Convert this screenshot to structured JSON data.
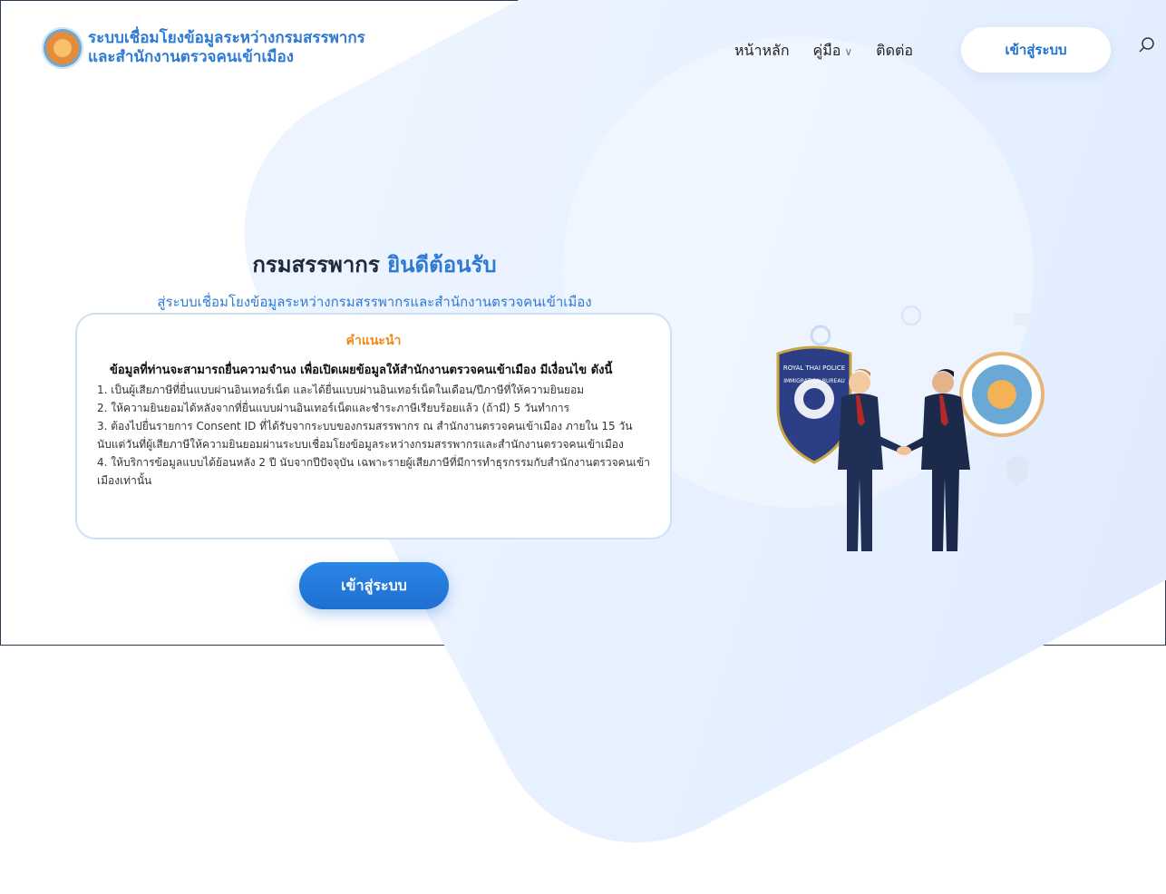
{
  "header": {
    "logo_title_line1": "ระบบเชื่อมโยงข้อมูลระหว่างกรมสรรพากร",
    "logo_title_line2": "และสำนักงานตรวจคนเข้าเมือง",
    "nav": [
      {
        "label": "หน้าหลัก"
      },
      {
        "label": "คู่มือ"
      },
      {
        "label": "ติดต่อ"
      }
    ],
    "login_button": "เข้าสู่ระบบ"
  },
  "welcome": {
    "title_part1": "กรมสรรพากร",
    "title_part2": "ยินดีต้อนรับ",
    "subtitle": "สู่ระบบเชื่อมโยงข้อมูลระหว่างกรมสรรพากรและสำนักงานตรวจคนเข้าเมือง"
  },
  "instructions": {
    "title": "คำแนะนำ",
    "lead": "ข้อมูลที่ท่านจะสามารถยื่นความจำนง เพื่อเปิดเผยข้อมูลให้สำนักงานตรวจคนเข้าเมือง มีเงื่อนไข ดังนี้",
    "items": [
      "1. เป็นผู้เสียภาษีที่ยื่นแบบผ่านอินเทอร์เน็ต และได้ยื่นแบบผ่านอินเทอร์เน็ตในเดือน/ปีภาษีที่ให้ความยินยอม",
      "2. ให้ความยินยอมได้หลังจากที่ยื่นแบบผ่านอินเทอร์เน็ตและชำระภาษีเรียบร้อยแล้ว (ถ้ามี) 5 วันทำการ",
      "3. ต้องไปยื่นรายการ Consent ID ที่ได้รับจากระบบของกรมสรรพากร ณ สำนักงานตรวจคนเข้าเมือง ภายใน 15 วัน นับแต่วันที่ผู้เสียภาษีให้ความยินยอมผ่านระบบเชื่อมโยงข้อมูลระหว่างกรมสรรพากรและสำนักงานตรวจคนเข้าเมือง",
      "4. ให้บริการข้อมูลแบบได้ย้อนหลัง 2 ปี นับจากปีปัจจุบัน เฉพาะรายผู้เสียภาษีที่มีการทำธุรกรรมกับสำนักงานตรวจคนเข้าเมืองเท่านั้น"
    ]
  },
  "cta_button": "เข้าสู่ระบบ",
  "illustration": {
    "badge_text": "ROYAL THAI POLICE",
    "badge_sub": "IMMIGRATION BUREAU"
  },
  "colors": {
    "accent": "#2f7ad3",
    "cta": "#1e6fd0",
    "instruction_title": "#ef8a1a"
  }
}
